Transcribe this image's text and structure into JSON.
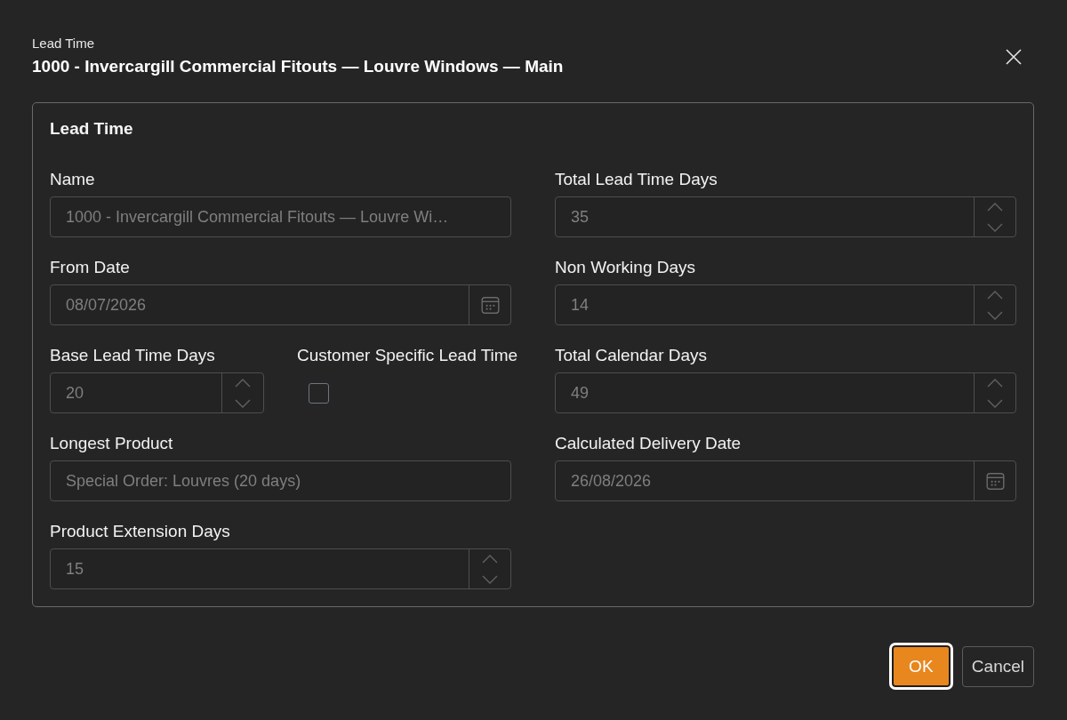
{
  "dialog": {
    "caption": "Lead Time",
    "title": "1000 - Invercargill Commercial Fitouts — Louvre Windows — Main"
  },
  "group": {
    "title": "Lead Time",
    "left_column": [
      {
        "kind": "text",
        "label": "Name",
        "value": "1000 - Invercargill Commercial Fitouts — Louvre Wi…",
        "disabled": true
      },
      {
        "kind": "date",
        "label": "From Date",
        "value": "08/07/2026",
        "disabled": true
      },
      {
        "kind": "row",
        "fields": [
          {
            "kind": "number",
            "label": "Base Lead Time Days",
            "value": "20",
            "disabled": true
          },
          {
            "kind": "checkbox",
            "label": "Customer Specific Lead Time",
            "checked": false
          }
        ]
      },
      {
        "kind": "text",
        "label": "Longest Product",
        "value": "Special Order: Louvres (20 days)",
        "disabled": true
      },
      {
        "kind": "number",
        "label": "Product Extension Days",
        "value": "15",
        "disabled": true
      }
    ],
    "right_column": [
      {
        "kind": "number",
        "label": "Total Lead Time Days",
        "value": "35",
        "disabled": true
      },
      {
        "kind": "number",
        "label": "Non Working Days",
        "value": "14",
        "disabled": true
      },
      {
        "kind": "number",
        "label": "Total Calendar Days",
        "value": "49",
        "disabled": true
      },
      {
        "kind": "date",
        "label": "Calculated Delivery Date",
        "value": "26/08/2026",
        "disabled": true
      }
    ]
  },
  "buttons": [
    {
      "kind": "primary",
      "label": "OK",
      "focused": true
    },
    {
      "kind": "secondary",
      "label": "Cancel",
      "focused": false
    }
  ]
}
